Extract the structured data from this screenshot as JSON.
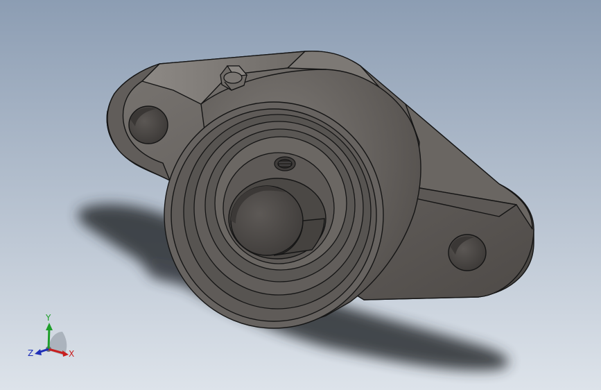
{
  "viewport": {
    "background_top": "#8c9db3",
    "background_bottom": "#dde3ea"
  },
  "model": {
    "part": "two-bolt-flange-bearing",
    "body_color": "#6f6b67",
    "edge_color": "#151515"
  },
  "triad": {
    "x_label": "X",
    "y_label": "Y",
    "z_label": "Z",
    "x_color": "#c81e1e",
    "y_color": "#1e9e2a",
    "z_color": "#1f2fb8"
  }
}
